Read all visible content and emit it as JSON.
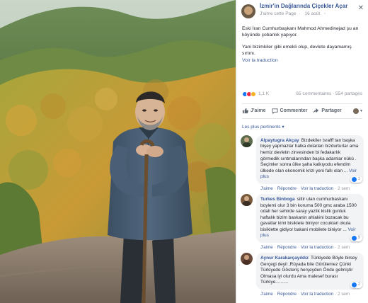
{
  "post": {
    "page_name": "İzmir'in Dağlarında Çiçekler Açar",
    "like_page": "J'aime cette Page",
    "date": "16 août",
    "text_1": "Eski İran Cumhurbaşkanı Mahmod Ahmedinejad şu an köyünde çobanlık yapıyor.",
    "text_2": "Yani bizimkiler gibi emekli olup, devlete dayamamış sırtını.",
    "translate": "Voir la traduction",
    "reaction_count": "1,1 K",
    "stats": "65 commentaires · 554 partages"
  },
  "actions": {
    "like": "J'aime",
    "comment": "Commenter",
    "share": "Partager"
  },
  "sort_label": "Les plus pertinents ▾",
  "comments": [
    {
      "name": "Alpaytugra Akçay",
      "text": "Bizdekiler israfff tan başka bişey yapmazlar halka dolarları bizdurturlar ama hemiz devletin zirvesinden bi fedakarlık görmedik sıntmalarından başka adamlar nükü . Seçimler sonra ülke şaha kalkıyodu efendim ülkede olan ekonomik krizi yeni fallı olan ...",
      "see_more": "Voir plus",
      "like": "J'aime",
      "reply": "Répondre",
      "translate": "Voir la traduction",
      "time": "2 sem",
      "reactions": "1"
    },
    {
      "name": "Turkes Binboga",
      "text": "siltir ulan cumhurbaskanı boylemi olur 3 bin koruma 500 gmc araba 1500 odali her sehirde saray yazlik kislik gunluk haftalık bizim baskanin ahlakini bozacak bu gavatlar kimi bisiklete biniyor cocuklari okula bisiklette gidiyor bakani mobilete biniyor ...",
      "see_more": "Voir plus",
      "like": "J'aime",
      "reply": "Répondre",
      "translate": "Voir la traduction",
      "time": "2 sem",
      "reactions": "9"
    },
    {
      "name": "Aynur Karakarçayıldız",
      "text": "Türkiyede Böyle birsey Gerçegi deyil ,Rüyada bile Görülemez Çünki Türkiyede Gösteriş herşeyden Önde gelmiştir Olmasa iyi olurdu Ama malesef burası Türkiye..........",
      "see_more": "",
      "like": "J'aime",
      "reply": "Répondre",
      "translate": "Voir la traduction",
      "time": "2 sem",
      "reactions": "2"
    }
  ],
  "colors": {
    "link": "#385898",
    "like_blue": "#1877f2",
    "bubble": "#f2f3f5",
    "muted": "#90949c"
  }
}
